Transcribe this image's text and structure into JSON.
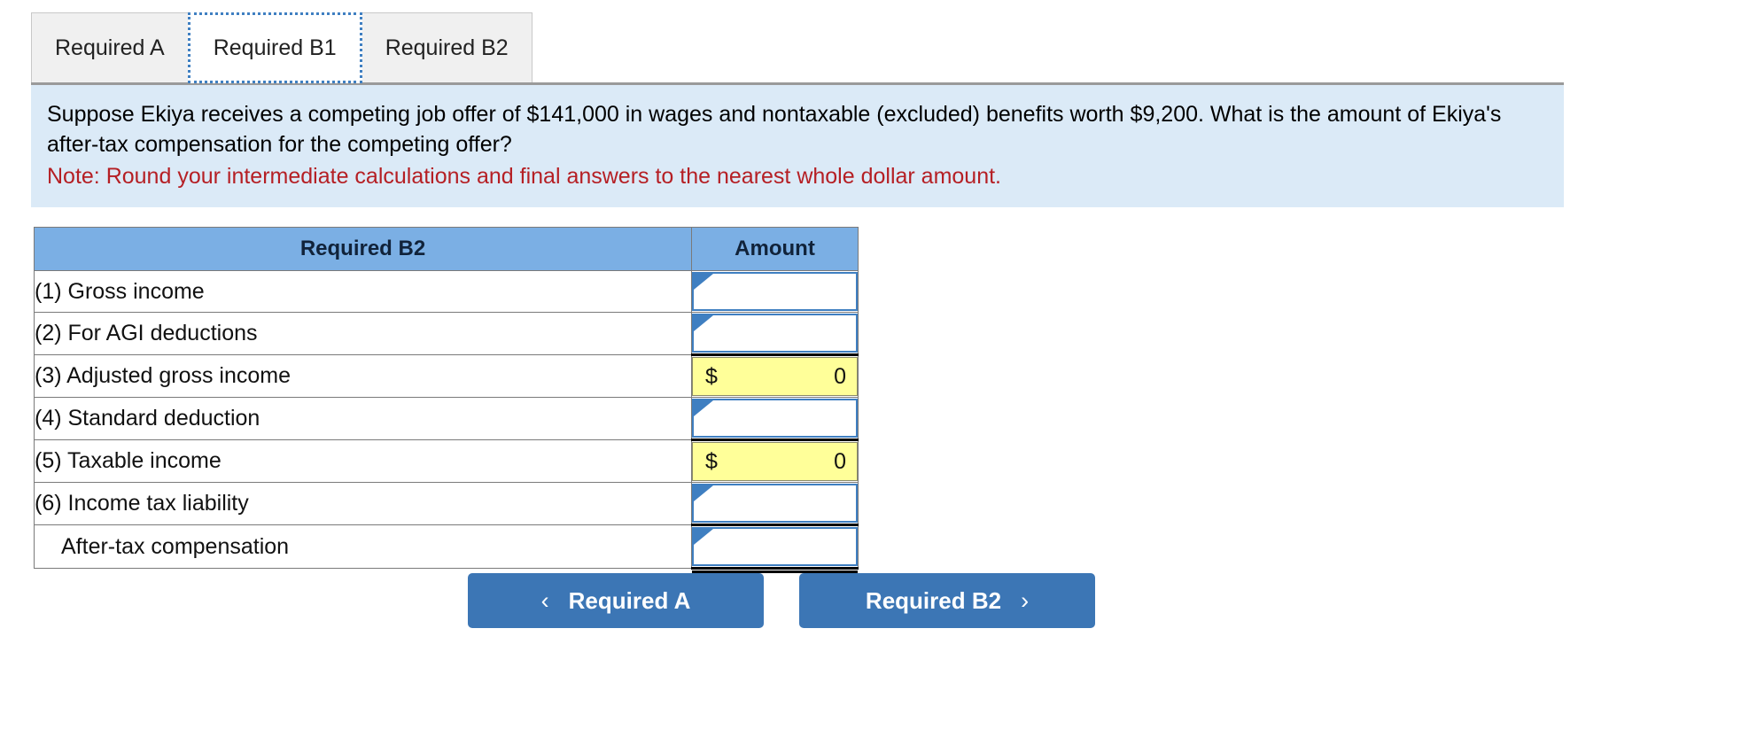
{
  "tabs": [
    {
      "label": "Required A",
      "active": false
    },
    {
      "label": "Required B1",
      "active": true
    },
    {
      "label": "Required B2",
      "active": false
    }
  ],
  "question": {
    "text": "Suppose Ekiya receives a competing job offer of $141,000 in wages and nontaxable (excluded) benefits worth $9,200. What is the amount of Ekiya's after-tax compensation for the competing offer?",
    "note": "Note: Round your intermediate calculations and final answers to the nearest whole dollar amount."
  },
  "table": {
    "header_label": "Required B2",
    "header_amount": "Amount",
    "rows": [
      {
        "label": "(1) Gross income",
        "type": "input",
        "value": ""
      },
      {
        "label": "(2) For AGI deductions",
        "type": "input",
        "value": ""
      },
      {
        "label": "(3) Adjusted gross income",
        "type": "calc",
        "currency": "$",
        "value": "0"
      },
      {
        "label": "(4) Standard deduction",
        "type": "input",
        "value": ""
      },
      {
        "label": "(5) Taxable income",
        "type": "calc",
        "currency": "$",
        "value": "0"
      },
      {
        "label": "(6) Income tax liability",
        "type": "input",
        "value": ""
      },
      {
        "label": "After-tax compensation",
        "type": "input",
        "value": ""
      }
    ]
  },
  "nav": {
    "prev_label": "Required A",
    "next_label": "Required B2",
    "prev_chevron": "‹",
    "next_chevron": "›"
  },
  "colors": {
    "header_blue": "#7bafe4",
    "panel_blue": "#dbeaf7",
    "note_red": "#b51f24",
    "button_blue": "#3c76b5",
    "input_border_blue": "#3f7fc1",
    "calc_yellow": "#ffff99"
  }
}
